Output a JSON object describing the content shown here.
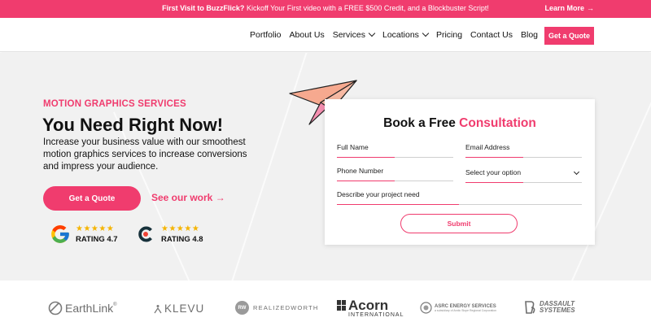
{
  "announcement": {
    "bold": "First Visit to BuzzFlick?",
    "text": " Kickoff Your First video with a FREE $500 Credit, and a Blockbuster Script!",
    "link": "Learn More",
    "link_arrow": "→"
  },
  "nav": {
    "items": [
      {
        "label": "Portfolio",
        "dropdown": false
      },
      {
        "label": "About Us",
        "dropdown": false
      },
      {
        "label": "Services",
        "dropdown": true
      },
      {
        "label": "Locations",
        "dropdown": true
      },
      {
        "label": "Pricing",
        "dropdown": false
      },
      {
        "label": "Contact Us",
        "dropdown": false
      },
      {
        "label": "Blog",
        "dropdown": false
      }
    ],
    "cta": "Get a Quote"
  },
  "hero": {
    "eyebrow": "MOTION GRAPHICS SERVICES",
    "headline": "You Need Right Now!",
    "subtext": "Increase your business value with our smoothest motion graphics services to increase conversions and impress your audience.",
    "cta": "Get a Quote",
    "secondary_link": "See our work →",
    "ratings": [
      {
        "icon": "google-icon",
        "stars": "★★★★★",
        "label": "RATING 4.7"
      },
      {
        "icon": "clutch-icon",
        "stars": "★★★★★",
        "label": "RATING 4.8"
      }
    ]
  },
  "form": {
    "title_plain": "Book a Free ",
    "title_accent": "Consultation",
    "fields": {
      "full_name": "Full Name",
      "email": "Email Address",
      "phone": "Phone Number",
      "option": "Select your option",
      "describe": "Describe your project need"
    },
    "submit": "Submit"
  },
  "clients": {
    "earthlink": "EarthLink",
    "earthlink_tm": "®",
    "klevu": "KLEVU",
    "realizedworth_mark": "RW",
    "realizedworth": "REALIZEDWORTH",
    "acorn": "Acorn",
    "acorn_sub": "INTERNATIONAL",
    "asrc": "ASRC ENERGY SERVICES",
    "asrc_sub": "a subsidiary of Arctic Slope Regional Corporation",
    "dassault_1": "DASSAULT",
    "dassault_2": "SYSTEMES"
  },
  "colors": {
    "accent": "#f03c6e",
    "hero_bg": "#f1f1f1",
    "star": "#f5b400"
  }
}
